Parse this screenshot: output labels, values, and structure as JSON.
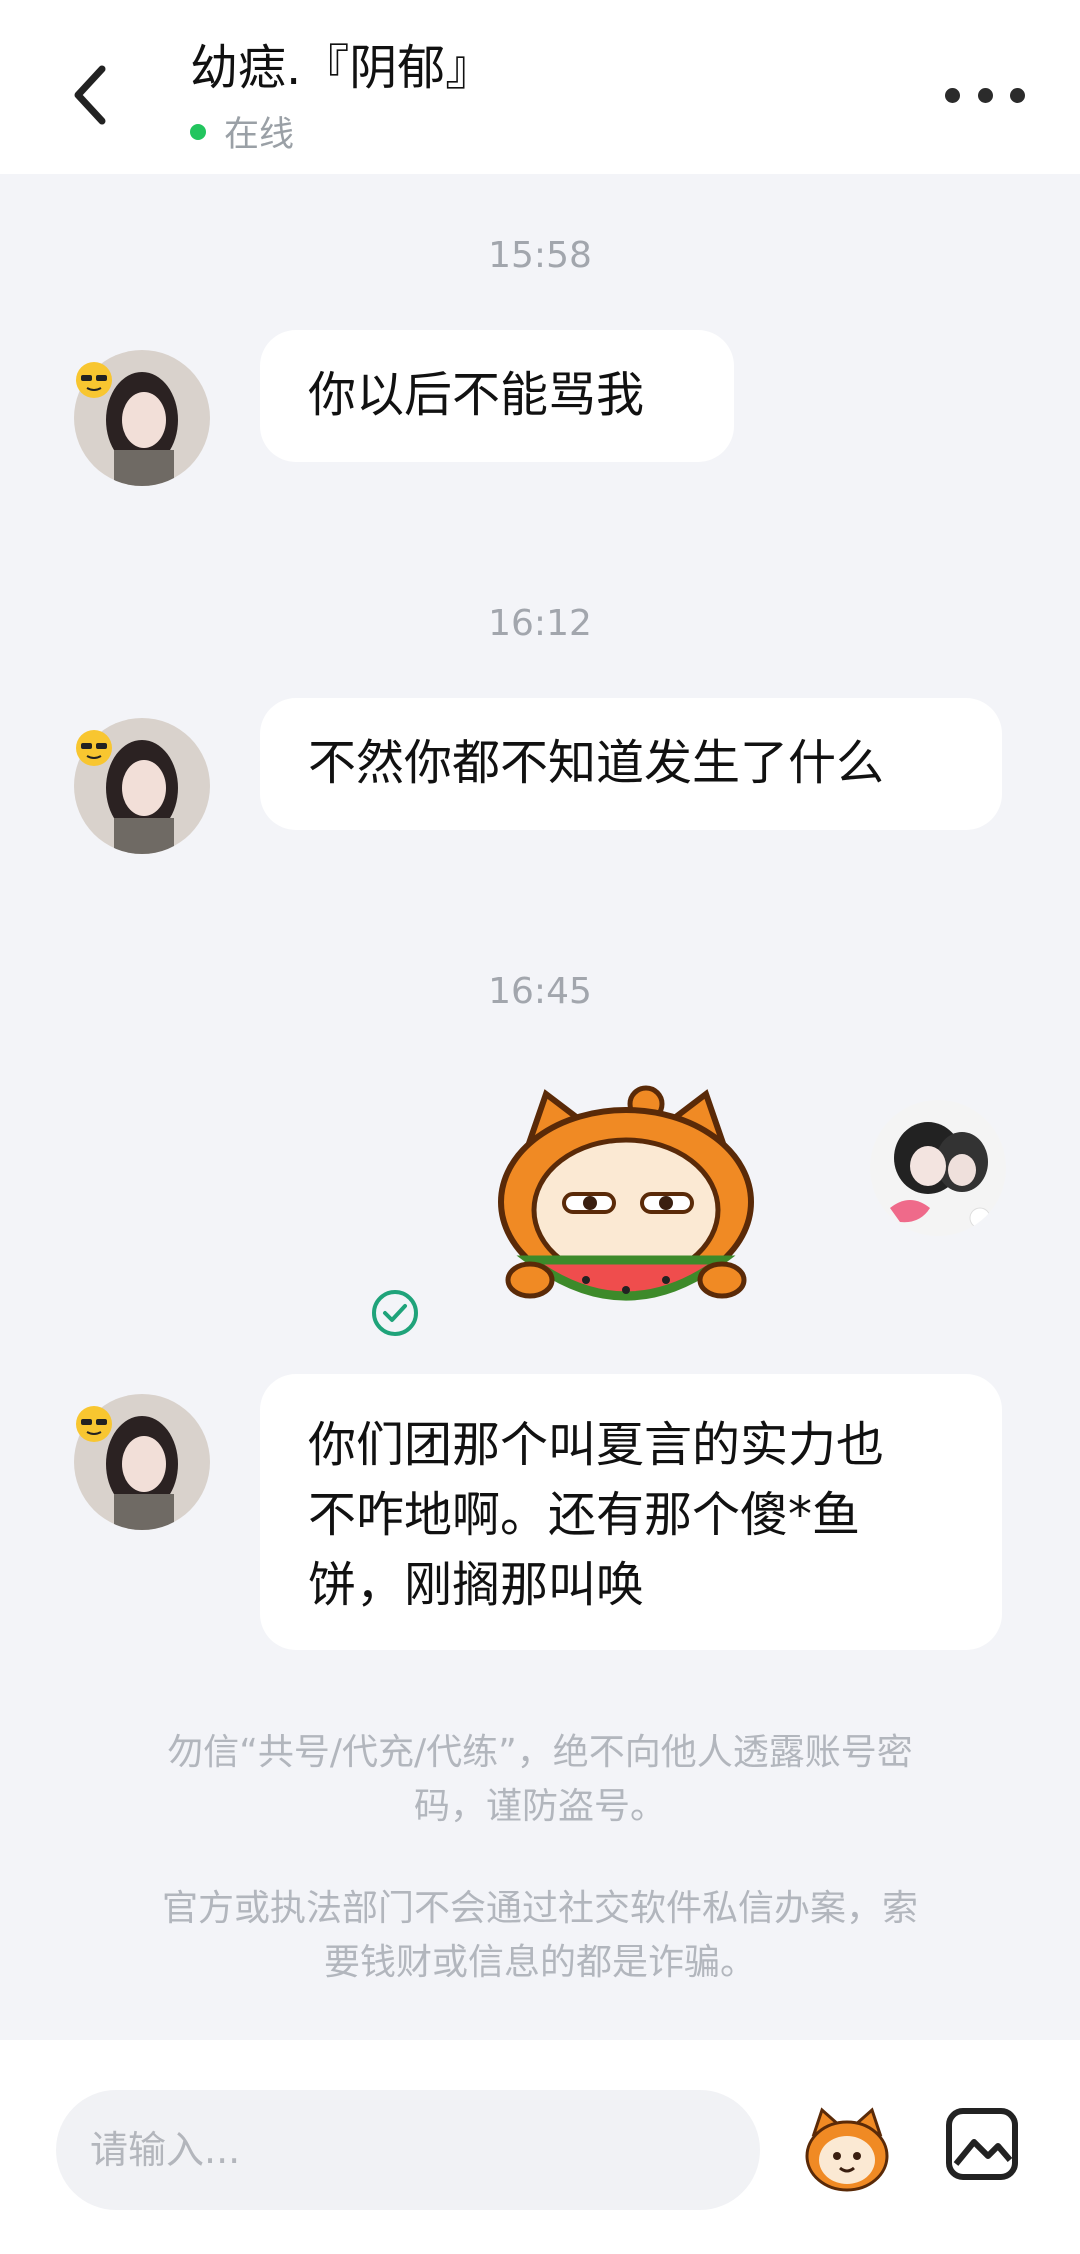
{
  "header": {
    "title": "幼痣.『阴郁』",
    "status": "在线",
    "status_color": "#22c55e"
  },
  "messages": [
    {
      "time": "15:58",
      "text": "你以后不能骂我",
      "side": "left"
    },
    {
      "time": "16:12",
      "text": "不然你都不知道发生了什么",
      "side": "left"
    },
    {
      "time": "16:45",
      "sticker": "orange-cat-eating-watermelon-sticker",
      "side": "right",
      "sent": true
    },
    {
      "text_lines": [
        "你们团那个叫夏言的实力也",
        "不咋地啊。还有那个傻*鱼",
        "饼，刚搁那叫唤"
      ],
      "side": "left"
    }
  ],
  "notices": [
    {
      "lines": [
        "勿信“共号/代充/代练”，绝不向他人透露账号密",
        "码，谨防盗号。"
      ]
    },
    {
      "lines": [
        "官方或执法部门不会通过社交软件私信办案，索",
        "要钱财或信息的都是诈骗。"
      ]
    }
  ],
  "composer": {
    "placeholder": "请输入...",
    "emoji_icon": "orange-cat-emoji-icon",
    "image_icon": "image-icon"
  }
}
